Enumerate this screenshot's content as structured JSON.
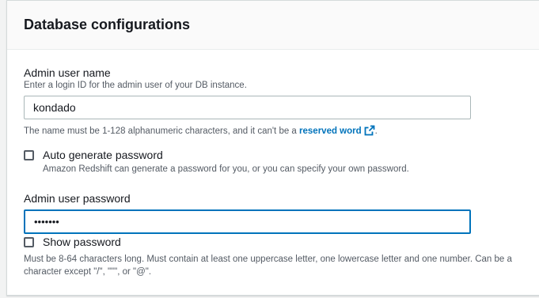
{
  "section": {
    "title": "Database configurations"
  },
  "admin_user": {
    "label": "Admin user name",
    "description": "Enter a login ID for the admin user of your DB instance.",
    "value": "kondado",
    "constraint_text": "The name must be 1-128 alphanumeric characters, and it can't be a ",
    "reserved_word_link": "reserved word",
    "constraint_suffix": "."
  },
  "auto_password": {
    "label": "Auto generate password",
    "description": "Amazon Redshift can generate a password for you, or you can specify your own password.",
    "checked": false
  },
  "admin_password": {
    "label": "Admin user password",
    "masked_value": "•••••••",
    "show_password_label": "Show password",
    "show_password_checked": false,
    "constraint_line1": "Must be 8-64 characters long. Must contain at least one uppercase letter, one lowercase letter and one number. Can be a",
    "constraint_line2": "character except \"/\", \"\"\", or \"@\"."
  },
  "icons": {
    "external_link": "external-link-icon"
  },
  "colors": {
    "link": "#0073bb",
    "focus_border": "#0073bb"
  }
}
